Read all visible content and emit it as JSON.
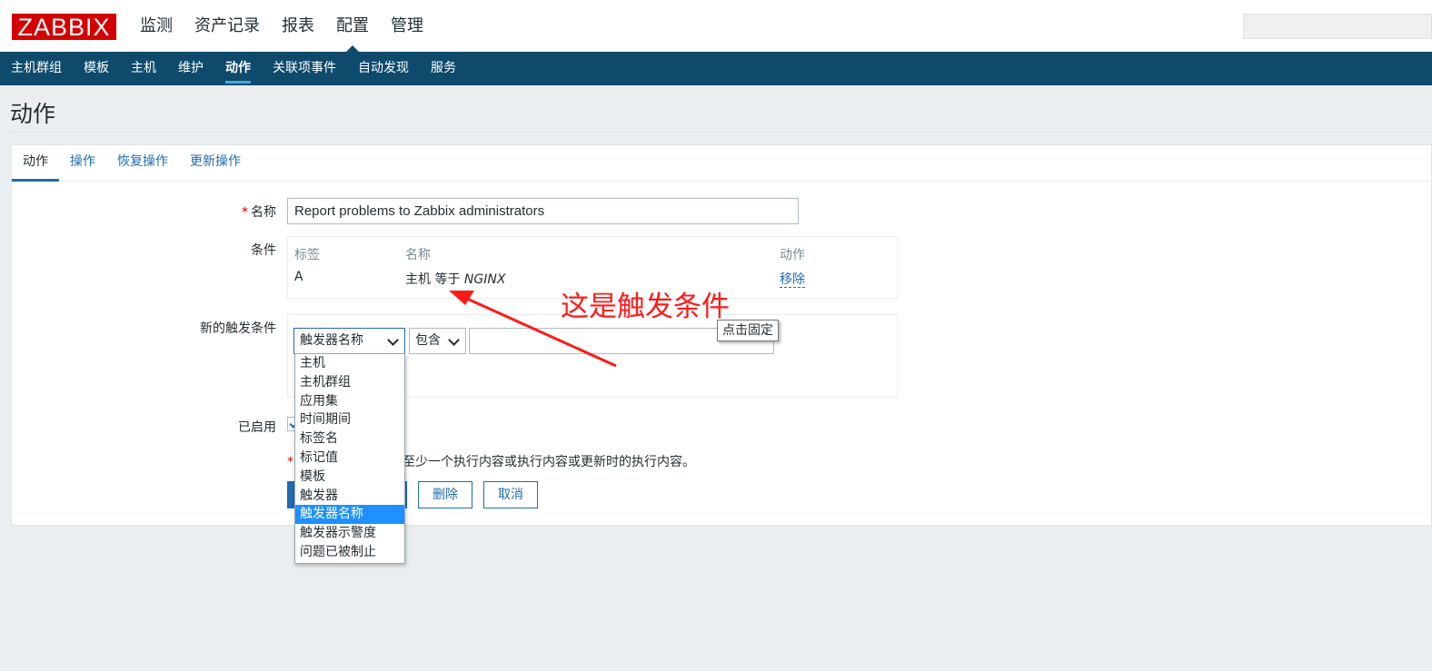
{
  "logo": "ZABBIX",
  "top_nav": [
    {
      "label": "监测",
      "active": false
    },
    {
      "label": "资产记录",
      "active": false
    },
    {
      "label": "报表",
      "active": false
    },
    {
      "label": "配置",
      "active": true
    },
    {
      "label": "管理",
      "active": false
    }
  ],
  "sub_nav": [
    {
      "label": "主机群组",
      "active": false
    },
    {
      "label": "模板",
      "active": false
    },
    {
      "label": "主机",
      "active": false
    },
    {
      "label": "维护",
      "active": false
    },
    {
      "label": "动作",
      "active": true
    },
    {
      "label": "关联项事件",
      "active": false
    },
    {
      "label": "自动发现",
      "active": false
    },
    {
      "label": "服务",
      "active": false
    }
  ],
  "page_title": "动作",
  "tabs": [
    {
      "label": "动作",
      "active": true
    },
    {
      "label": "操作",
      "active": false
    },
    {
      "label": "恢复操作",
      "active": false
    },
    {
      "label": "更新操作",
      "active": false
    }
  ],
  "form": {
    "required_mark": "*",
    "name_label": "名称",
    "name_value": "Report problems to Zabbix administrators",
    "conditions_label": "条件",
    "conditions_headers": {
      "tag": "标签",
      "name": "名称",
      "action": "动作"
    },
    "conditions_row": {
      "tag": "A",
      "name_prefix": "主机 等于 ",
      "name_value": "NGINX",
      "action": "移除"
    },
    "new_condition_label": "新的触发条件",
    "condition_type_selected": "触发器名称",
    "operator_selected": "包含",
    "condition_type_options": [
      "主机",
      "主机群组",
      "应用集",
      "时间期间",
      "标签名",
      "标记值",
      "模板",
      "触发器",
      "触发器名称",
      "触发器示警度",
      "问题已被制止"
    ],
    "condition_type_selected_index": 8,
    "enabled_label": "已启用",
    "note_visible_text": "至少一个执行内容或执行内容或更新时的执行内容。",
    "delete_button": "删除",
    "cancel_button": "取消"
  },
  "annotation_text": "这是触发条件",
  "tooltip_text": "点击固定",
  "colors": {
    "brand_red": "#d40000",
    "nav_dark": "#0e4a6b",
    "link_blue": "#1f6cb1",
    "annotation_red": "#ff1a1a",
    "dropdown_highlight": "#1e90ff"
  }
}
